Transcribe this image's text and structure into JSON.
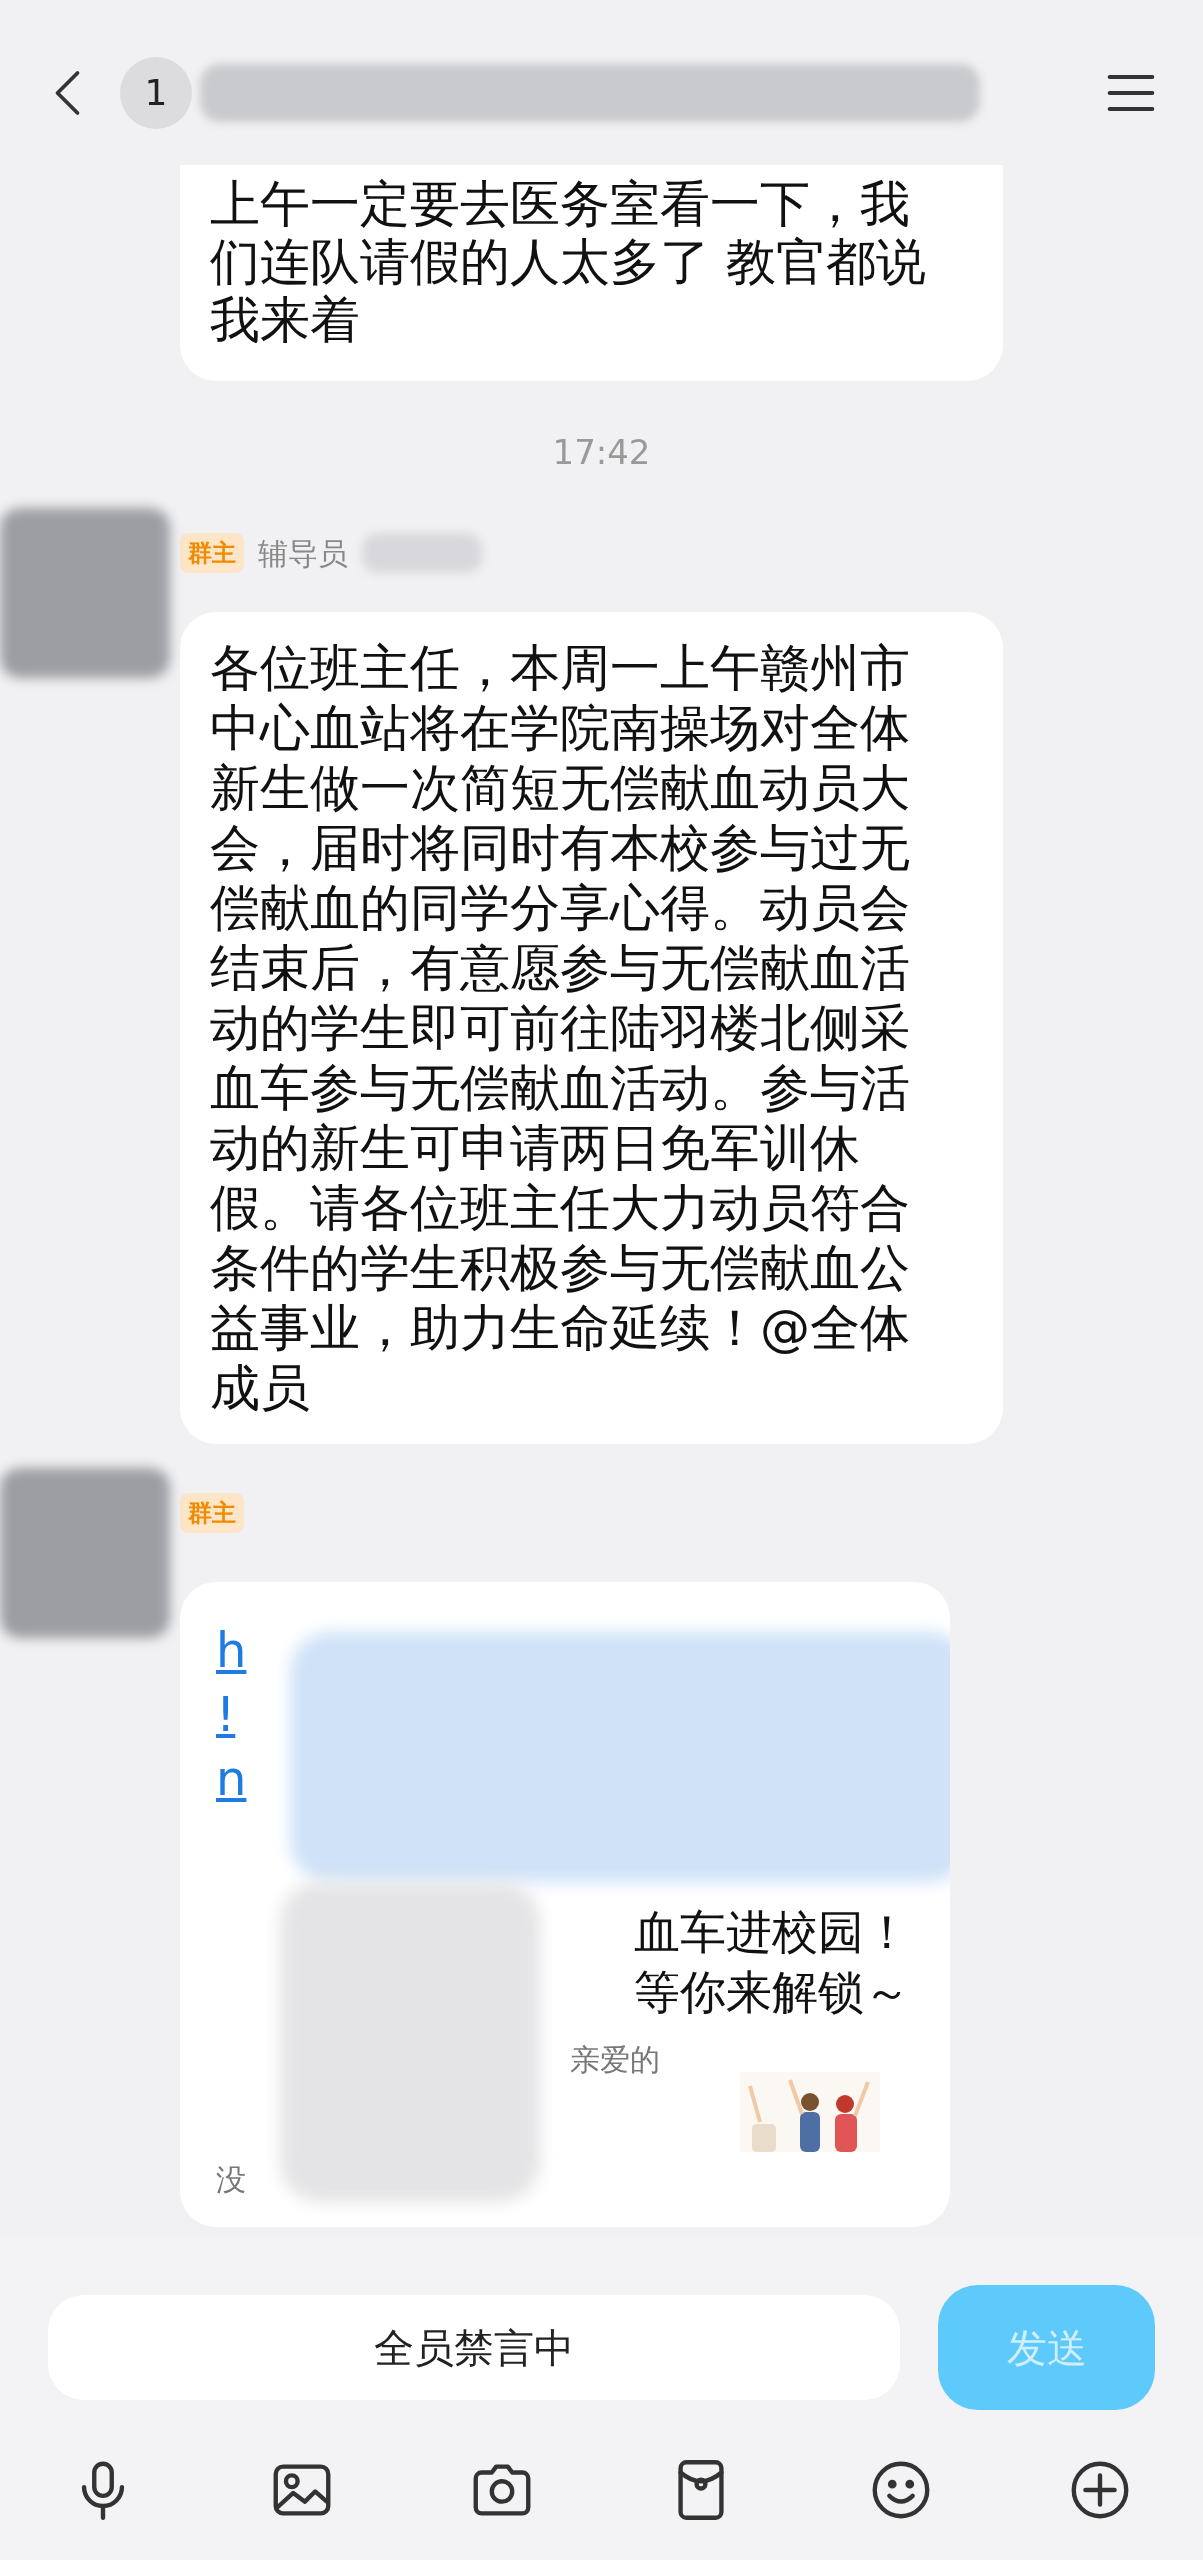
{
  "header": {
    "unread_count": "1"
  },
  "messages": [
    {
      "kind": "text_tail",
      "text": "上午一定要去医务室看一下，我们连队请假的人太多了 教官都说我来着"
    },
    {
      "kind": "time",
      "text": "17:42"
    },
    {
      "kind": "text",
      "badge": "群主",
      "sender": "辅导员",
      "text": "各位班主任，本周一上午赣州市中心血站将在学院南操场对全体新生做一次简短无偿献血动员大会，届时将同时有本校参与过无偿献血的同学分享心得。动员会结束后，有意愿参与无偿献血活动的学生即可前往陆羽楼北侧采血车参与无偿献血活动。参与活动的新生可申请两日免军训休假。请各位班主任大力动员符合条件的学生积极参与无偿献血公益事业，助力生命延续！@全体成员"
    },
    {
      "kind": "card",
      "badge": "群主",
      "link_lines": [
        "h",
        "!",
        "n"
      ],
      "title_lines": [
        "血车进校园！",
        "等你来解锁～"
      ],
      "summary_lines": [
        "亲爱的",
        "没"
      ]
    }
  ],
  "composer": {
    "placeholder": "全员禁言中",
    "send": "发送"
  }
}
